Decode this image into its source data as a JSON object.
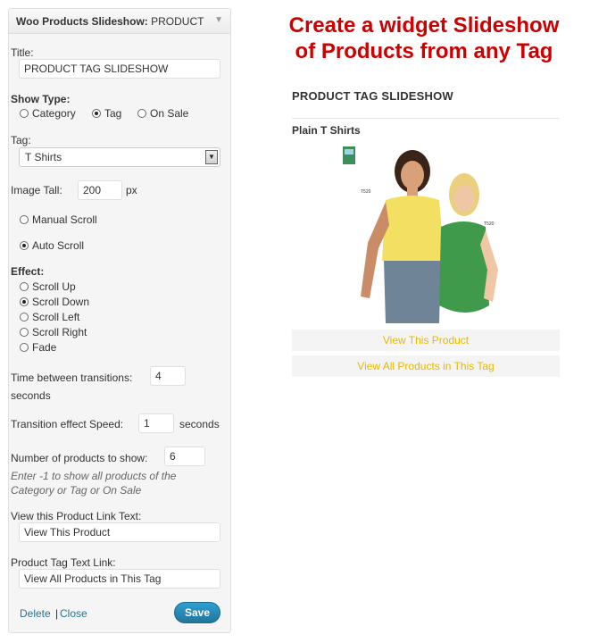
{
  "widget": {
    "header_title": "Woo Products Slideshow:",
    "header_subtitle": "PRODUCT TA",
    "title_label": "Title:",
    "title_value": "PRODUCT TAG SLIDESHOW",
    "show_type_label": "Show Type:",
    "show_type_options": [
      "Category",
      "Tag",
      "On Sale"
    ],
    "show_type_selected": "Tag",
    "tag_label": "Tag:",
    "tag_value": "T Shirts",
    "image_tall_label": "Image Tall:",
    "image_tall_value": "200",
    "image_tall_unit": "px",
    "scroll_options": [
      "Manual Scroll",
      "Auto Scroll"
    ],
    "scroll_selected": "Auto Scroll",
    "effect_label": "Effect:",
    "effect_options": [
      "Scroll Up",
      "Scroll Down",
      "Scroll Left",
      "Scroll Right",
      "Fade"
    ],
    "effect_selected": "Scroll Down",
    "time_between_label": "Time between transitions:",
    "time_between_value": "4",
    "time_between_unit": "seconds",
    "speed_label": "Transition effect Speed:",
    "speed_value": "1",
    "speed_unit": "seconds",
    "num_products_label": "Number of products to show:",
    "num_products_value": "6",
    "num_products_note": "Enter -1 to show all products of the Category or Tag or On Sale",
    "view_product_label": "View this Product Link Text:",
    "view_product_value": "View This Product",
    "tag_link_label": "Product Tag Text Link:",
    "tag_link_value": "View All Products in This Tag",
    "delete_label": "Delete",
    "separator": "|",
    "close_label": "Close",
    "save_label": "Save"
  },
  "preview": {
    "promo_line1": "Create a widget Slideshow",
    "promo_line2": "of Products from any Tag",
    "widget_title": "PRODUCT TAG SLIDESHOW",
    "product_name": "Plain T Shirts",
    "view_product_link": "View This Product",
    "view_all_link": "View All Products in This Tag"
  },
  "colors": {
    "promo_text": "#cc0000",
    "link_text": "#e6b800",
    "admin_link": "#21759b",
    "save_button": "#21759b"
  }
}
